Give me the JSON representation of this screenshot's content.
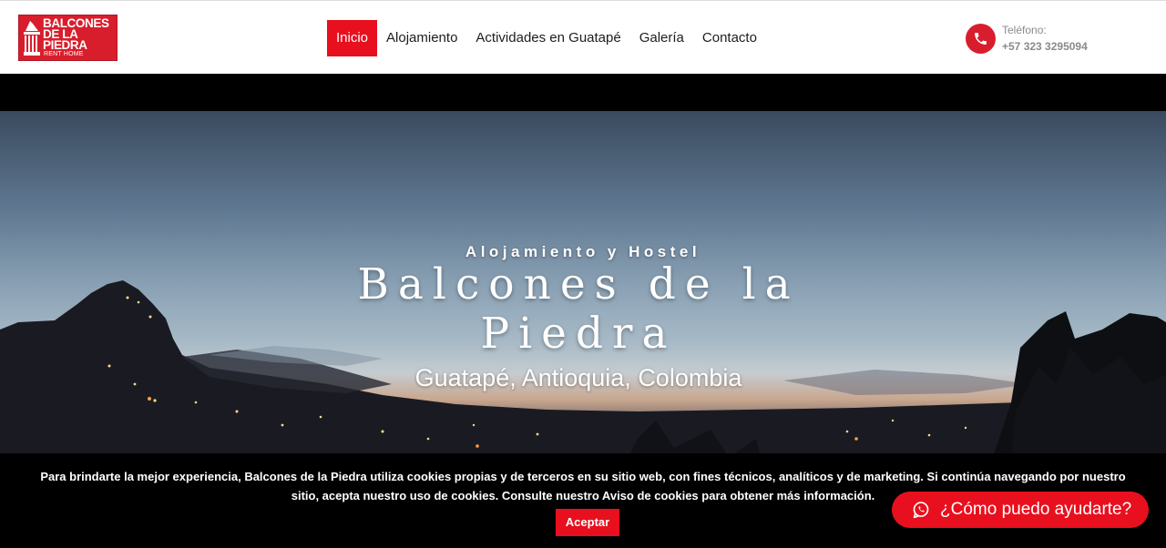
{
  "header": {
    "logo": {
      "line1": "BALCONES",
      "line2": "DE LA",
      "line3": "PIEDRA",
      "sub": "RENT HOME",
      "color": "#d81e2c"
    },
    "nav": [
      {
        "label": "Inicio",
        "active": true
      },
      {
        "label": "Alojamiento",
        "active": false
      },
      {
        "label": "Actividades en Guatapé",
        "active": false
      },
      {
        "label": "Galería",
        "active": false
      },
      {
        "label": "Contacto",
        "active": false
      }
    ],
    "phone": {
      "label": "Teléfono:",
      "number": "+57 323 3295094",
      "icon": "phone-icon"
    }
  },
  "hero": {
    "kicker": "Alojamiento y Hostel",
    "title": "Balcones de la Piedra",
    "subtitle": "Guatapé, Antioquia, Colombia"
  },
  "cookie": {
    "text": "Para brindarte la mejor experiencia, Balcones de la Piedra utiliza cookies propias y de terceros en su sitio web, con fines técnicos, analíticos y de marketing. Si continúa navegando por nuestro sitio, acepta nuestro uso de cookies. Consulte nuestro Aviso de cookies para obtener más información.",
    "accept_label": "Aceptar"
  },
  "whatsapp": {
    "label": "¿Cómo puedo ayudarte?",
    "icon": "whatsapp-icon"
  },
  "colors": {
    "accent": "#e8101e",
    "brand": "#d81e2c",
    "text_muted": "#8a8a8a"
  }
}
